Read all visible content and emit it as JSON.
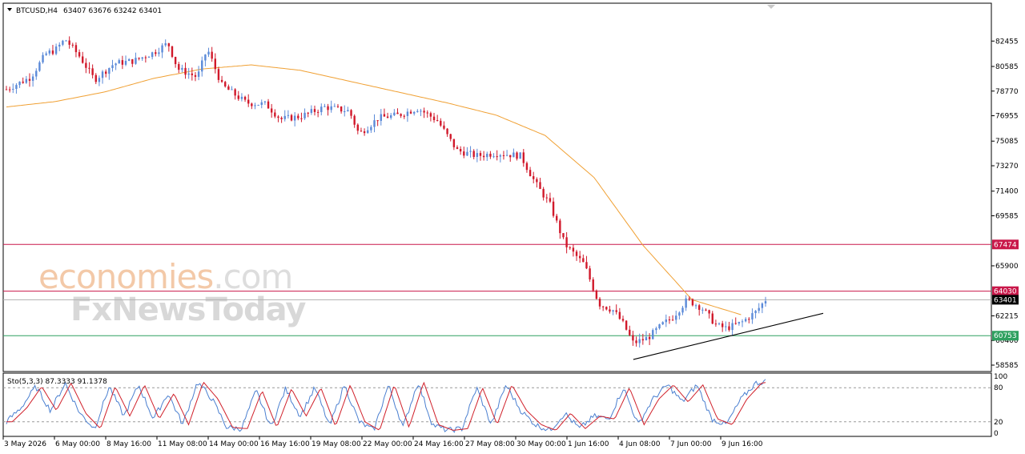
{
  "header": {
    "symbol": "BTCUSD,H4",
    "ohlc": "63407 63676 63242 63401"
  },
  "watermark": {
    "brand_a": "economies",
    "brand_b": ".com",
    "brand_c": "FxNewsToday"
  },
  "stochastic": {
    "label": "Sto(5,3,3) 87.3333 91.1378",
    "levels": [
      "100",
      "80",
      "20",
      "0"
    ]
  },
  "colors": {
    "bull": "#5b8ad8",
    "bear": "#d1192b",
    "ma": "#f0a033",
    "resistance": "#c9184a",
    "support": "#2fa060",
    "stoch_main": "#4a7fd0",
    "stoch_signal": "#d0202a"
  },
  "chart_data": {
    "type": "candlestick",
    "title": "BTCUSD,H4",
    "ylim": [
      58585,
      84300
    ],
    "y_ticks": [
      82455,
      80585,
      78770,
      76955,
      75085,
      73270,
      71400,
      69585,
      65900,
      62215,
      60400,
      58585
    ],
    "x_ticks": [
      "3 May 2026",
      "6 May 00:00",
      "8 May 16:00",
      "11 May 08:00",
      "14 May 00:00",
      "16 May 16:00",
      "19 May 08:00",
      "22 May 00:00",
      "24 May 16:00",
      "27 May 08:00",
      "30 May 00:00",
      "1 Jun 16:00",
      "4 Jun 08:00",
      "7 Jun 00:00",
      "9 Jun 16:00"
    ],
    "last_price": 63401,
    "horizontal_levels": [
      {
        "label": "67474",
        "value": 67474,
        "color": "#c9184a"
      },
      {
        "label": "64030",
        "value": 64030,
        "color": "#c9184a"
      },
      {
        "label": "60753",
        "value": 60753,
        "color": "#2fa060"
      }
    ],
    "current_price_label": "63401",
    "trendline": {
      "from": [
        0,
        59000
      ],
      "to": [
        16.5,
        62400
      ]
    },
    "moving_average_anchors": [
      [
        0,
        77600
      ],
      [
        1,
        78000
      ],
      [
        2,
        78700
      ],
      [
        3,
        79700
      ],
      [
        4,
        80400
      ],
      [
        5,
        80700
      ],
      [
        6,
        80300
      ],
      [
        7,
        79500
      ],
      [
        8,
        78700
      ],
      [
        9,
        77900
      ],
      [
        10,
        77000
      ],
      [
        11,
        75500
      ],
      [
        12,
        72400
      ],
      [
        13,
        67400
      ],
      [
        14,
        63400
      ],
      [
        15,
        62300
      ]
    ],
    "anchors": [
      [
        0,
        78900
      ],
      [
        0.5,
        79800
      ],
      [
        0.8,
        81500
      ],
      [
        1.0,
        81800
      ],
      [
        1.2,
        82600
      ],
      [
        1.5,
        81300
      ],
      [
        1.8,
        79600
      ],
      [
        2.2,
        80800
      ],
      [
        2.6,
        81000
      ],
      [
        3.0,
        81600
      ],
      [
        3.3,
        82300
      ],
      [
        3.5,
        80400
      ],
      [
        3.9,
        79800
      ],
      [
        4.1,
        81900
      ],
      [
        4.4,
        79200
      ],
      [
        4.9,
        77900
      ],
      [
        5.3,
        77800
      ],
      [
        5.6,
        76700
      ],
      [
        6.0,
        76900
      ],
      [
        6.5,
        77600
      ],
      [
        7.0,
        77300
      ],
      [
        7.2,
        75600
      ],
      [
        7.6,
        76800
      ],
      [
        8.0,
        77000
      ],
      [
        8.4,
        77500
      ],
      [
        8.8,
        76600
      ],
      [
        9.2,
        74400
      ],
      [
        9.6,
        74000
      ],
      [
        10.0,
        74200
      ],
      [
        10.5,
        74000
      ],
      [
        10.8,
        72000
      ],
      [
        11.1,
        70400
      ],
      [
        11.4,
        67500
      ],
      [
        11.8,
        66000
      ],
      [
        12.1,
        63100
      ],
      [
        12.4,
        62600
      ],
      [
        12.6,
        61600
      ],
      [
        12.8,
        60200
      ],
      [
        13.1,
        60600
      ],
      [
        13.4,
        61600
      ],
      [
        13.6,
        62100
      ],
      [
        13.9,
        63400
      ],
      [
        14.2,
        62800
      ],
      [
        14.5,
        61500
      ],
      [
        14.7,
        61300
      ],
      [
        15.0,
        61700
      ],
      [
        15.3,
        62500
      ],
      [
        15.5,
        63400
      ]
    ],
    "stoch_anchors": [
      [
        0,
        20
      ],
      [
        0.3,
        45
      ],
      [
        0.6,
        82
      ],
      [
        0.9,
        40
      ],
      [
        1.2,
        88
      ],
      [
        1.5,
        35
      ],
      [
        1.8,
        8
      ],
      [
        2.1,
        82
      ],
      [
        2.4,
        30
      ],
      [
        2.7,
        85
      ],
      [
        3.0,
        25
      ],
      [
        3.3,
        70
      ],
      [
        3.6,
        15
      ],
      [
        3.9,
        90
      ],
      [
        4.2,
        60
      ],
      [
        4.5,
        10
      ],
      [
        4.8,
        8
      ],
      [
        5.1,
        75
      ],
      [
        5.4,
        10
      ],
      [
        5.7,
        78
      ],
      [
        6.0,
        30
      ],
      [
        6.3,
        80
      ],
      [
        6.6,
        12
      ],
      [
        6.9,
        85
      ],
      [
        7.2,
        20
      ],
      [
        7.5,
        5
      ],
      [
        7.8,
        85
      ],
      [
        8.1,
        10
      ],
      [
        8.4,
        90
      ],
      [
        8.7,
        15
      ],
      [
        9.0,
        5
      ],
      [
        9.3,
        8
      ],
      [
        9.6,
        80
      ],
      [
        9.9,
        15
      ],
      [
        10.2,
        85
      ],
      [
        10.5,
        40
      ],
      [
        10.8,
        15
      ],
      [
        11.1,
        5
      ],
      [
        11.4,
        35
      ],
      [
        11.7,
        8
      ],
      [
        12.0,
        30
      ],
      [
        12.3,
        25
      ],
      [
        12.6,
        80
      ],
      [
        12.9,
        15
      ],
      [
        13.2,
        60
      ],
      [
        13.5,
        85
      ],
      [
        13.8,
        55
      ],
      [
        14.1,
        85
      ],
      [
        14.4,
        25
      ],
      [
        14.7,
        15
      ],
      [
        15.0,
        60
      ],
      [
        15.3,
        88
      ],
      [
        15.5,
        91
      ]
    ]
  }
}
